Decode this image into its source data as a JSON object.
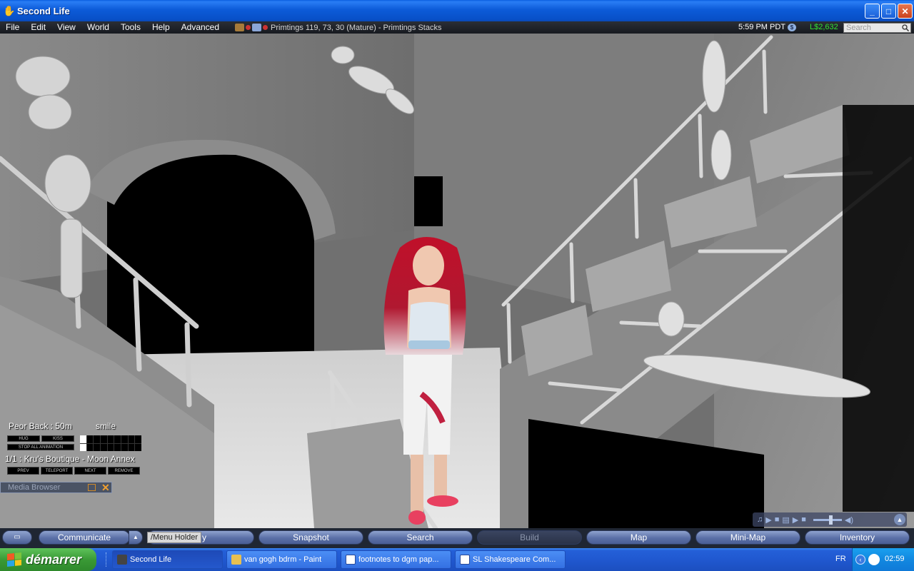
{
  "window": {
    "title": "Second Life",
    "icon": "sl-hand-icon"
  },
  "menubar": {
    "items": [
      "File",
      "Edit",
      "View",
      "World",
      "Tools",
      "Help",
      "Advanced"
    ],
    "location": "Primtings 119, 73, 30 (Mature) - Primtings Stacks",
    "clock": "5:59 PM PDT",
    "balance": "L$2,632",
    "search_placeholder": "Search"
  },
  "hud": {
    "range": "Peor Back : 50m",
    "gesture": "smile",
    "hug": "HUG",
    "kiss": "KISS",
    "stop_all": "STOP ALL ANIMATION",
    "boutique": "1/1 : Kru's Boutique - Moon Annex",
    "nav": [
      "PREV",
      "TELEPORT",
      "NEXT",
      "REMOVE"
    ]
  },
  "media_browser": {
    "label": "Media Browser"
  },
  "toolbar": {
    "communicate": "Communicate",
    "obscured_label": "y",
    "menu_holder": "/Menu Holder",
    "snapshot": "Snapshot",
    "search": "Search",
    "build": "Build",
    "map": "Map",
    "minimap": "Mini-Map",
    "inventory": "Inventory"
  },
  "taskbar": {
    "start": "démarrer",
    "tasks": [
      {
        "label": "Second Life",
        "active": true
      },
      {
        "label": "van gogh bdrm - Paint",
        "active": false
      },
      {
        "label": "footnotes to dgm pap...",
        "active": false
      },
      {
        "label": "SL Shakespeare Com...",
        "active": false
      }
    ],
    "lang": "FR",
    "time": "02:59"
  },
  "colors": {
    "balance": "#33e033",
    "title_bar": "#0c5bd8",
    "start": "#3a9a36"
  }
}
